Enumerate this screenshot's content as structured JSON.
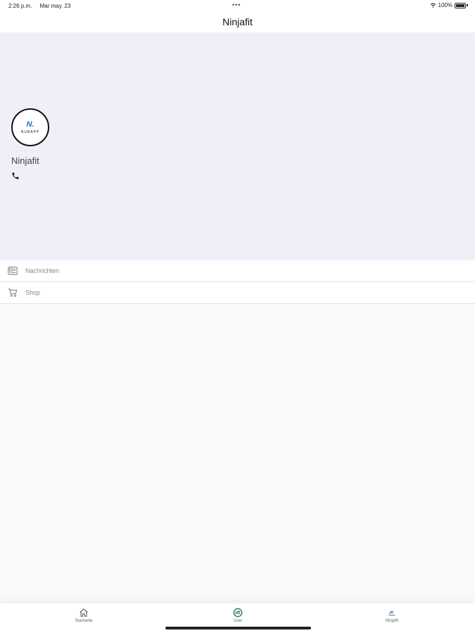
{
  "status_bar": {
    "time": "2:26 p.m.",
    "date": "Mar may. 23",
    "dots": "•••",
    "battery": "100%"
  },
  "nav": {
    "title": "Ninjafit"
  },
  "profile": {
    "logo_mark": "N.",
    "logo_text": "NUBAPP",
    "name": "Ninjafit",
    "icons": {
      "phone": "phone-icon"
    }
  },
  "menu": {
    "items": [
      {
        "label": "Nachrichten",
        "icon": "news-icon"
      },
      {
        "label": "Shop",
        "icon": "cart-icon"
      }
    ]
  },
  "tabs": {
    "items": [
      {
        "label": "Startseite",
        "icon": "home-icon"
      },
      {
        "label": "User",
        "icon": "user-icon"
      },
      {
        "label": "Ninjafit",
        "icon": "ninjafit-logo-icon"
      }
    ],
    "active_color": "#2e7d4f"
  }
}
